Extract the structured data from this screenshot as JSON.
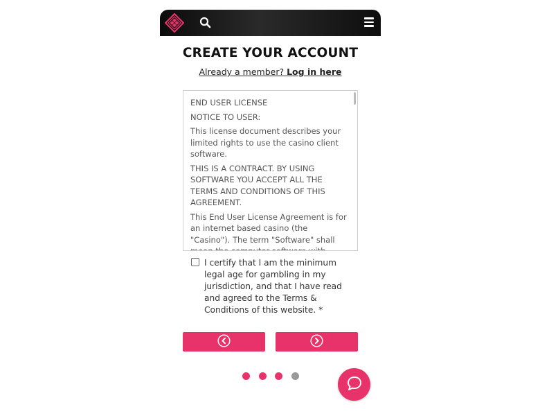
{
  "colors": {
    "accent": "#e8336a",
    "topbar": "#111111",
    "dot_inactive": "#999999"
  },
  "header": {
    "logo_icon": "diamond-logo-icon",
    "search_icon": "search-icon",
    "menu_icon": "hamburger-menu-icon"
  },
  "page": {
    "title": "CREATE YOUR ACCOUNT",
    "member_prefix": "Already a member?",
    "login_link": "Log in here"
  },
  "license": {
    "paragraphs": [
      "END USER LICENSE",
      "NOTICE TO USER:",
      "This license document describes your limited rights to use the casino client software.",
      "THIS IS A CONTRACT. BY USING SOFTWARE YOU ACCEPT ALL THE TERMS AND CONDITIONS OF THIS AGREEMENT.",
      "This End User License Agreement is for an internet based casino (the \"Casino\"). The term \"Software\" shall mean the computer software with which this End User License"
    ]
  },
  "certify": {
    "checked": false,
    "text": "I certify that I am the minimum legal age for gambling in my jurisdiction, and that I have read and agreed to the Terms & Conditions of this website. *"
  },
  "navigation": {
    "prev_icon": "chevron-left-icon",
    "next_icon": "chevron-right-icon"
  },
  "steps": {
    "total": 4,
    "current": 3
  },
  "chat": {
    "icon": "chat-bubble-icon"
  }
}
